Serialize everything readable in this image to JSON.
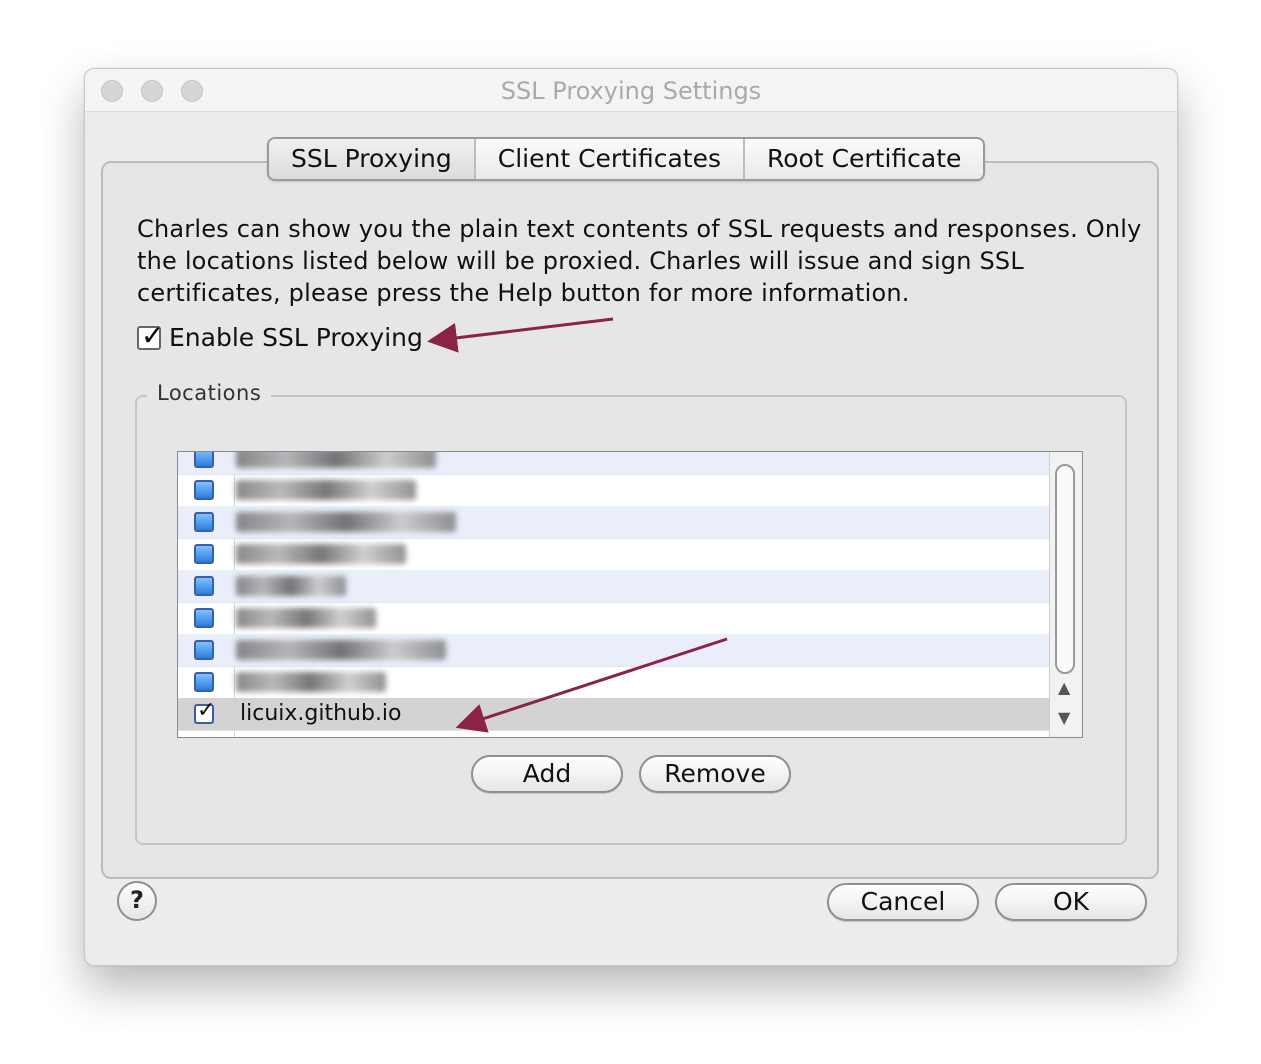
{
  "window": {
    "title": "SSL Proxying Settings"
  },
  "tabs": [
    {
      "label": "SSL Proxying",
      "active": true
    },
    {
      "label": "Client Certificates",
      "active": false
    },
    {
      "label": "Root Certificate",
      "active": false
    }
  ],
  "description": "Charles can show you the plain text contents of SSL requests and responses. Only the locations listed below will be proxied. Charles will issue and sign SSL certificates, please press the Help button for more information.",
  "enable_ssl": {
    "label": "Enable SSL Proxying",
    "checked": true
  },
  "locations": {
    "label": "Locations",
    "rows": [
      {
        "host": "",
        "blurred": true,
        "checked": true,
        "selected": false
      },
      {
        "host": "",
        "blurred": true,
        "checked": true,
        "selected": false
      },
      {
        "host": "",
        "blurred": true,
        "checked": true,
        "selected": false
      },
      {
        "host": "",
        "blurred": true,
        "checked": true,
        "selected": false
      },
      {
        "host": "",
        "blurred": true,
        "checked": true,
        "selected": false
      },
      {
        "host": "",
        "blurred": true,
        "checked": true,
        "selected": false
      },
      {
        "host": "",
        "blurred": true,
        "checked": true,
        "selected": false
      },
      {
        "host": "",
        "blurred": true,
        "checked": true,
        "selected": false
      },
      {
        "host": "licuix.github.io",
        "blurred": false,
        "checked": true,
        "selected": true
      }
    ]
  },
  "buttons": {
    "add": "Add",
    "remove": "Remove",
    "cancel": "Cancel",
    "ok": "OK",
    "help": "?"
  },
  "icons": {
    "scroll_up": "scroll-up-icon",
    "scroll_down": "scroll-down-icon",
    "checkbox_tick": "check-icon"
  },
  "colors": {
    "annotation_arrow": "#8b2346",
    "checkbox_blue": "#2f7cdb",
    "selected_row": "#d3d3d3",
    "alt_row": "#e9eefa"
  }
}
